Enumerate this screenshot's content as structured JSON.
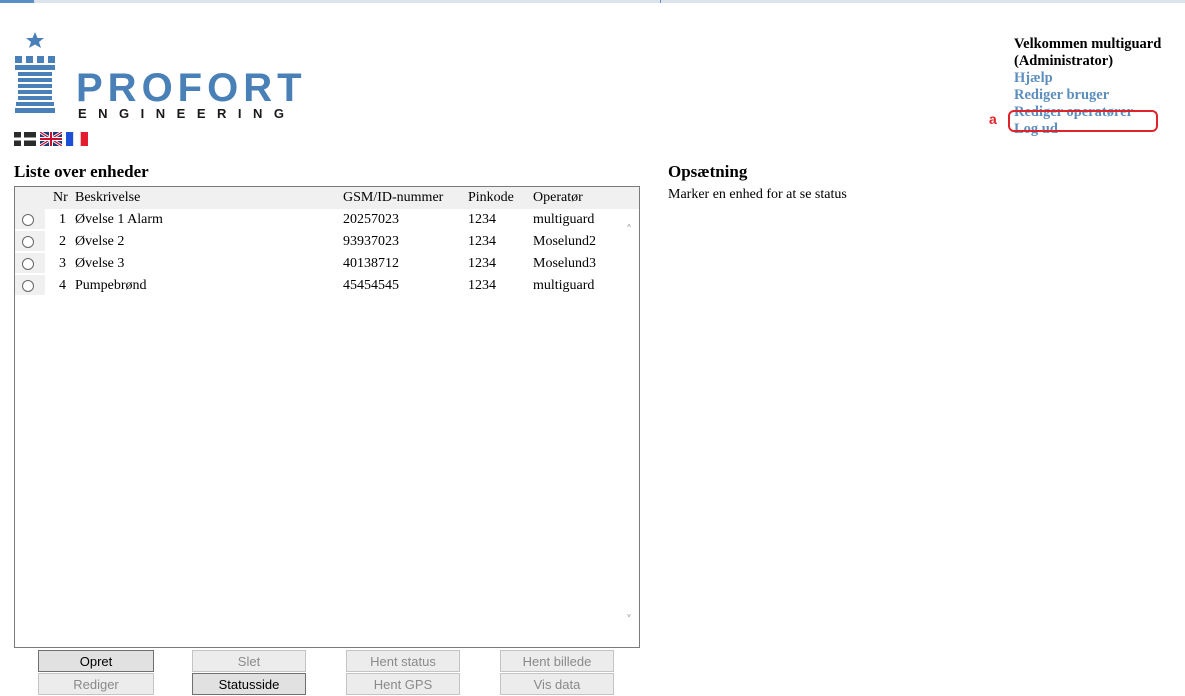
{
  "logo": {
    "brand": "PROFORT",
    "subtitle": "ENGINEERING"
  },
  "flags": [
    "danish-flag",
    "uk-flag",
    "french-flag"
  ],
  "user_panel": {
    "welcome_line1": "Velkommen multiguard",
    "welcome_line2": "(Administrator)",
    "links": [
      "Hjælp",
      "Rediger bruger",
      "Rediger operatører",
      "Log ud"
    ],
    "annotation": "a",
    "highlight_color": "#e0232b",
    "link_color": "#5d8fbe"
  },
  "list": {
    "title": "Liste over enheder",
    "columns": {
      "nr": "Nr",
      "desc": "Beskrivelse",
      "gsm": "GSM/ID-nummer",
      "pin": "Pinkode",
      "op": "Operatør"
    },
    "rows": [
      {
        "nr": "1",
        "desc": "Øvelse 1 Alarm",
        "gsm": "20257023",
        "pin": "1234",
        "op": "multiguard"
      },
      {
        "nr": "2",
        "desc": "Øvelse 2",
        "gsm": "93937023",
        "pin": "1234",
        "op": "Moselund2"
      },
      {
        "nr": "3",
        "desc": "Øvelse 3",
        "gsm": "40138712",
        "pin": "1234",
        "op": "Moselund3"
      },
      {
        "nr": "4",
        "desc": "Pumpebrønd",
        "gsm": "45454545",
        "pin": "1234",
        "op": "multiguard"
      }
    ]
  },
  "setup": {
    "title": "Opsætning",
    "text": "Marker en enhed for at se status"
  },
  "buttons": {
    "opret": "Opret",
    "slet": "Slet",
    "hent_status": "Hent status",
    "hent_billede": "Hent billede",
    "rediger": "Rediger",
    "statusside": "Statusside",
    "hent_gps": "Hent GPS",
    "vis_data": "Vis data"
  },
  "colors": {
    "brand_blue": "#4a80b8"
  }
}
